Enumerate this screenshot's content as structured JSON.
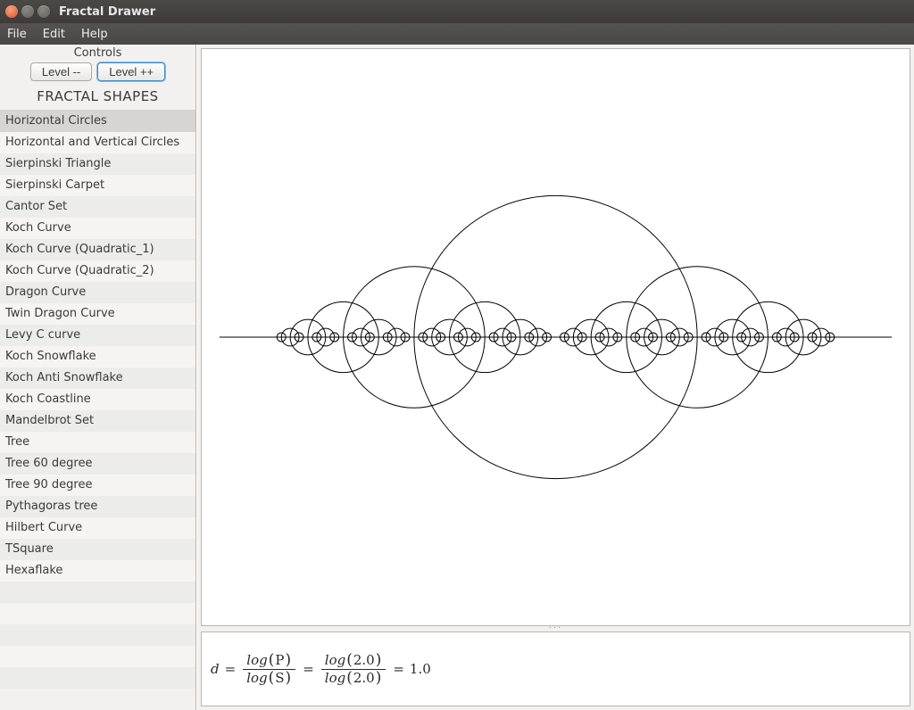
{
  "window": {
    "title": "Fractal Drawer"
  },
  "menu": {
    "file": "File",
    "edit": "Edit",
    "help": "Help"
  },
  "sidebar": {
    "controls_label": "Controls",
    "level_dec": "Level --",
    "level_inc": "Level ++",
    "header": "FRACTAL SHAPES",
    "items": [
      "Horizontal Circles",
      "Horizontal and Vertical Circles",
      "Sierpinski Triangle",
      "Sierpinski Carpet",
      "Cantor Set",
      "Koch Curve",
      "Koch Curve (Quadratic_1)",
      "Koch Curve (Quadratic_2)",
      "Dragon Curve",
      "Twin Dragon Curve",
      "Levy C curve",
      "Koch Snowflake",
      "Koch Anti Snowflake",
      "Koch Coastline",
      "Mandelbrot Set",
      "Tree",
      "Tree 60 degree",
      "Tree 90 degree",
      "Pythagoras tree",
      "Hilbert Curve",
      "TSquare",
      "Hexaflake"
    ],
    "selected_index": 0
  },
  "formula": {
    "lhs": "d",
    "eq": " = ",
    "fn": "log",
    "P": "P",
    "S": "S",
    "Pval": "2.0",
    "Sval": "2.0",
    "result": "1.0"
  },
  "fractal": {
    "type": "horizontal_circles",
    "depth": 6
  }
}
